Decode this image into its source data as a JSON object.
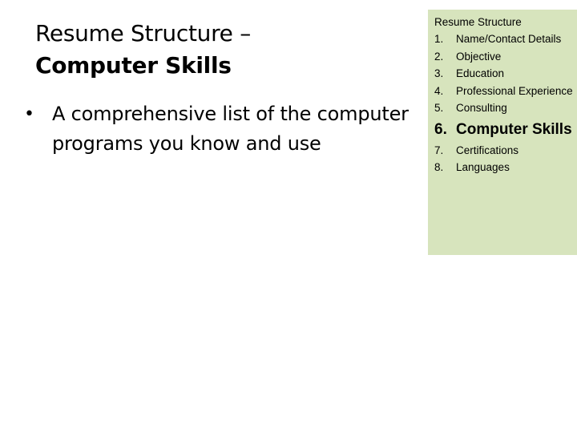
{
  "slide": {
    "title_line1": "Resume Structure –",
    "title_line2": "Computer Skills",
    "bullets": [
      {
        "icon": "bullet-dot-icon",
        "symbol": "•",
        "text": "A comprehensive list of the computer programs you know and use"
      }
    ]
  },
  "sidebox": {
    "background": "#d7e4bd",
    "title": "Resume Structure",
    "steps": [
      {
        "num": "1.",
        "label": "Name/Contact Details",
        "active": false
      },
      {
        "num": "2.",
        "label": "Objective",
        "active": false
      },
      {
        "num": "3.",
        "label": "Education",
        "active": false
      },
      {
        "num": "4.",
        "label": "Professional Experience",
        "active": false
      },
      {
        "num": "5.",
        "label": "Consulting",
        "active": false
      },
      {
        "num": "6.",
        "label": "Computer Skills",
        "active": true
      },
      {
        "num": "7.",
        "label": "Certifications",
        "active": false
      },
      {
        "num": "8.",
        "label": "Languages",
        "active": false
      }
    ]
  }
}
